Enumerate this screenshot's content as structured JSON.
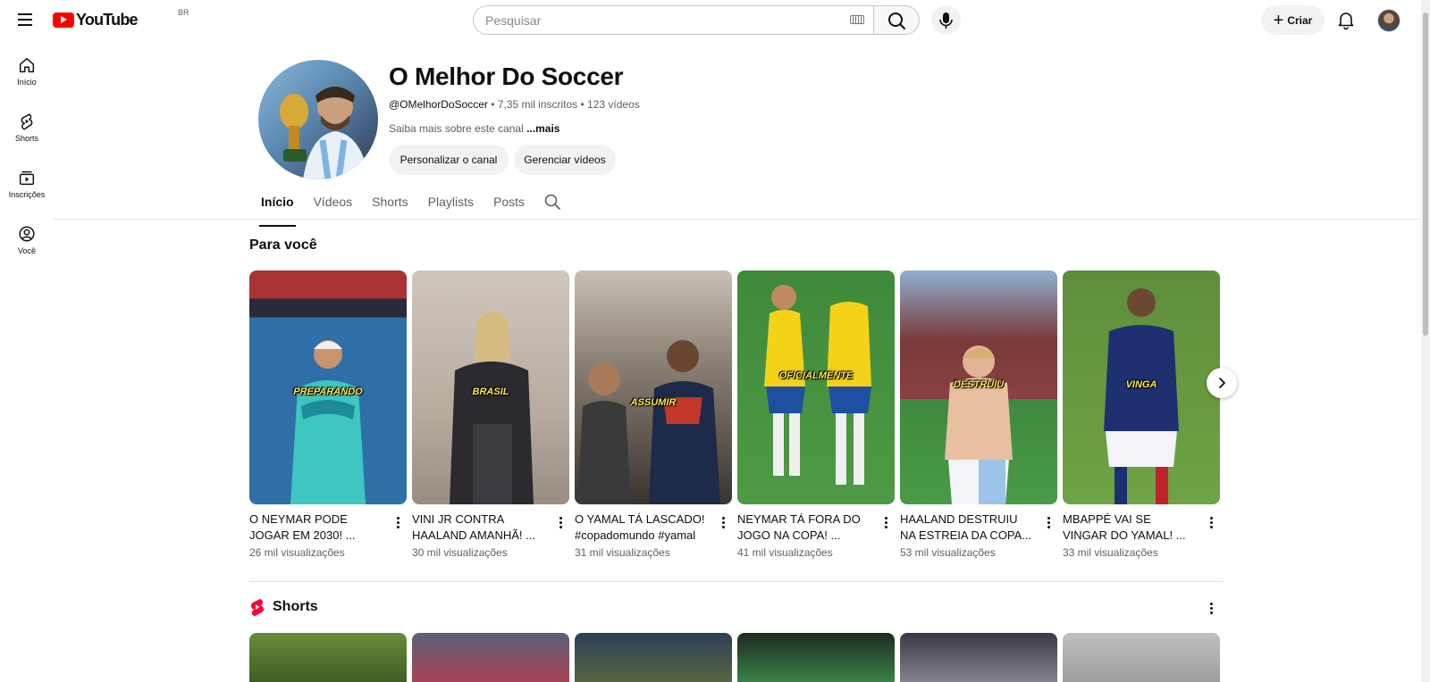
{
  "header": {
    "logo_text": "YouTube",
    "region": "BR",
    "search_placeholder": "Pesquisar",
    "create_label": "Criar"
  },
  "rail": [
    {
      "label": "Início",
      "icon": "home-icon"
    },
    {
      "label": "Shorts",
      "icon": "shorts-icon"
    },
    {
      "label": "Inscrições",
      "icon": "subscriptions-icon"
    },
    {
      "label": "Você",
      "icon": "you-icon"
    }
  ],
  "channel": {
    "name": "O Melhor Do Soccer",
    "handle": "@OMelhorDoSoccer",
    "subscribers": "7,35 mil inscritos",
    "videos_count": "123 vídeos",
    "separator": "•",
    "about_text": "Saiba mais sobre este canal",
    "about_more": "...mais",
    "customize_label": "Personalizar o canal",
    "manage_label": "Gerenciar vídeos"
  },
  "tabs": [
    "Início",
    "Vídeos",
    "Shorts",
    "Playlists",
    "Posts"
  ],
  "for_you": {
    "title": "Para você",
    "items": [
      {
        "title": "O NEYMAR PODE JOGAR EM 2030! ...",
        "views": "26 mil visualizações",
        "caption": "PREPARANDO"
      },
      {
        "title": "VINI JR CONTRA HAALAND AMANHÃ! ...",
        "views": "30 mil visualizações",
        "caption": "BRASIL"
      },
      {
        "title": "O YAMAL TÁ LASCADO! #copadomundo #yamal",
        "views": "31 mil visualizações",
        "caption": "ASSUMIR"
      },
      {
        "title": "NEYMAR TÁ FORA DO JOGO NA COPA! ...",
        "views": "41 mil visualizações",
        "caption": "OFICIALMENTE"
      },
      {
        "title": "HAALAND DESTRUIU NA ESTREIA DA COPA...",
        "views": "53 mil visualizações",
        "caption": "DESTRUIU"
      },
      {
        "title": "MBAPPÉ VAI SE VINGAR DO YAMAL! ...",
        "views": "33 mil visualizações",
        "caption": "VINGA"
      }
    ]
  },
  "shorts_section": {
    "title": "Shorts"
  },
  "colors": {
    "brand_red": "#ff0000",
    "text_primary": "#0f0f0f",
    "text_secondary": "#606060",
    "chip_bg": "#f2f2f2"
  }
}
